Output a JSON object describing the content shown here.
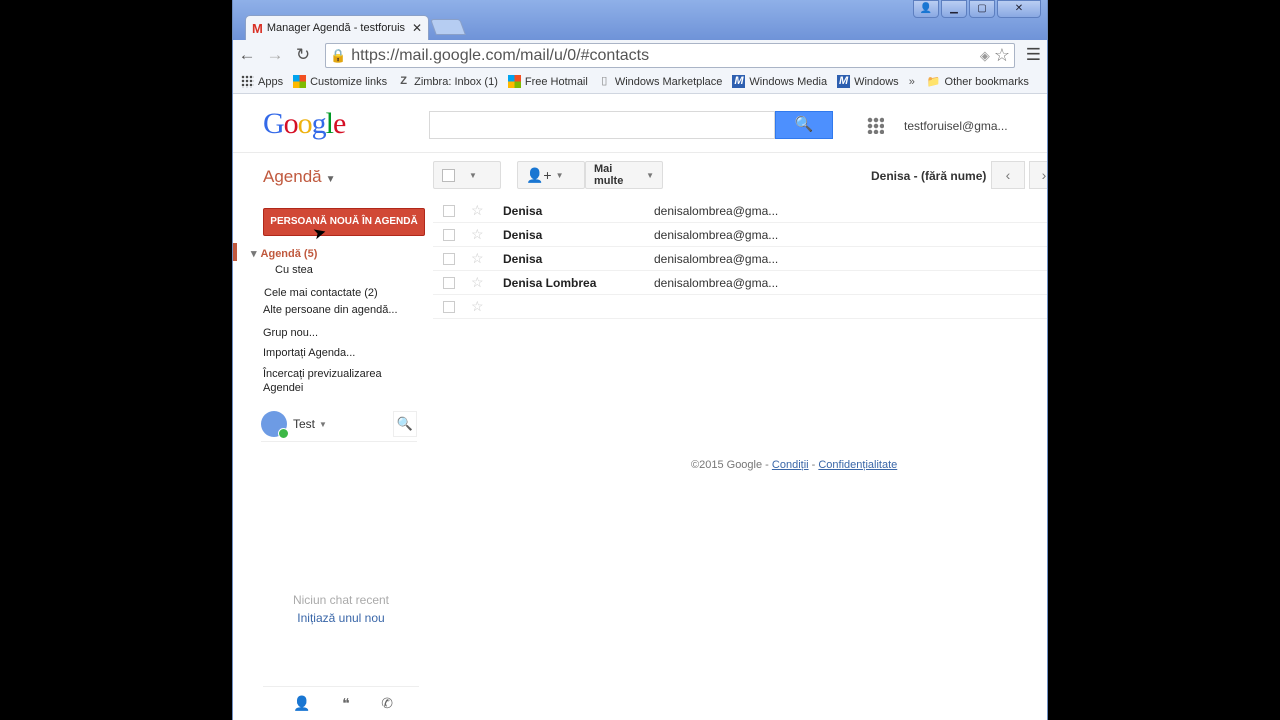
{
  "browser": {
    "tab_title": "Manager Agendă - testforuis",
    "url": "https://mail.google.com/mail/u/0/#contacts",
    "bookmarks": [
      "Apps",
      "Customize links",
      "Zimbra: Inbox (1)",
      "Free Hotmail",
      "Windows Marketplace",
      "Windows Media",
      "Windows"
    ],
    "more_bookmarks": "»",
    "other_bookmarks": "Other bookmarks"
  },
  "header": {
    "logo": [
      "G",
      "o",
      "o",
      "g",
      "l",
      "e"
    ],
    "account": "testforuisel@gma..."
  },
  "app": {
    "name": "Agendă",
    "more_label": "Mai multe",
    "contact_title": "Denisa - (fără nume)",
    "new_button": "PERSOANĂ NOUĂ ÎN AGENDĂ"
  },
  "sidebar": {
    "agenda": "Agendă (5)",
    "starred": "Cu stea",
    "frequent": "Cele mai contactate (2)",
    "other": "Alte persoane din agendă...",
    "new_group": "Grup nou...",
    "import": "Importați Agenda...",
    "preview_1": "Încercați previzualizarea",
    "preview_2": "Agendei"
  },
  "chat": {
    "name": "Test",
    "no_recent": "Niciun chat recent",
    "start": "Inițiază unul nou"
  },
  "contacts": [
    {
      "name": "Denisa",
      "email": "denisalombrea@gma..."
    },
    {
      "name": "Denisa",
      "email": "denisalombrea@gma..."
    },
    {
      "name": "Denisa",
      "email": "denisalombrea@gma..."
    },
    {
      "name": "Denisa Lombrea",
      "email": "denisalombrea@gma..."
    },
    {
      "name": "",
      "email": ""
    }
  ],
  "footer": {
    "copyright": "©2015 Google",
    "sep": " - ",
    "terms": "Condiții",
    "privacy": "Confidențialitate"
  }
}
